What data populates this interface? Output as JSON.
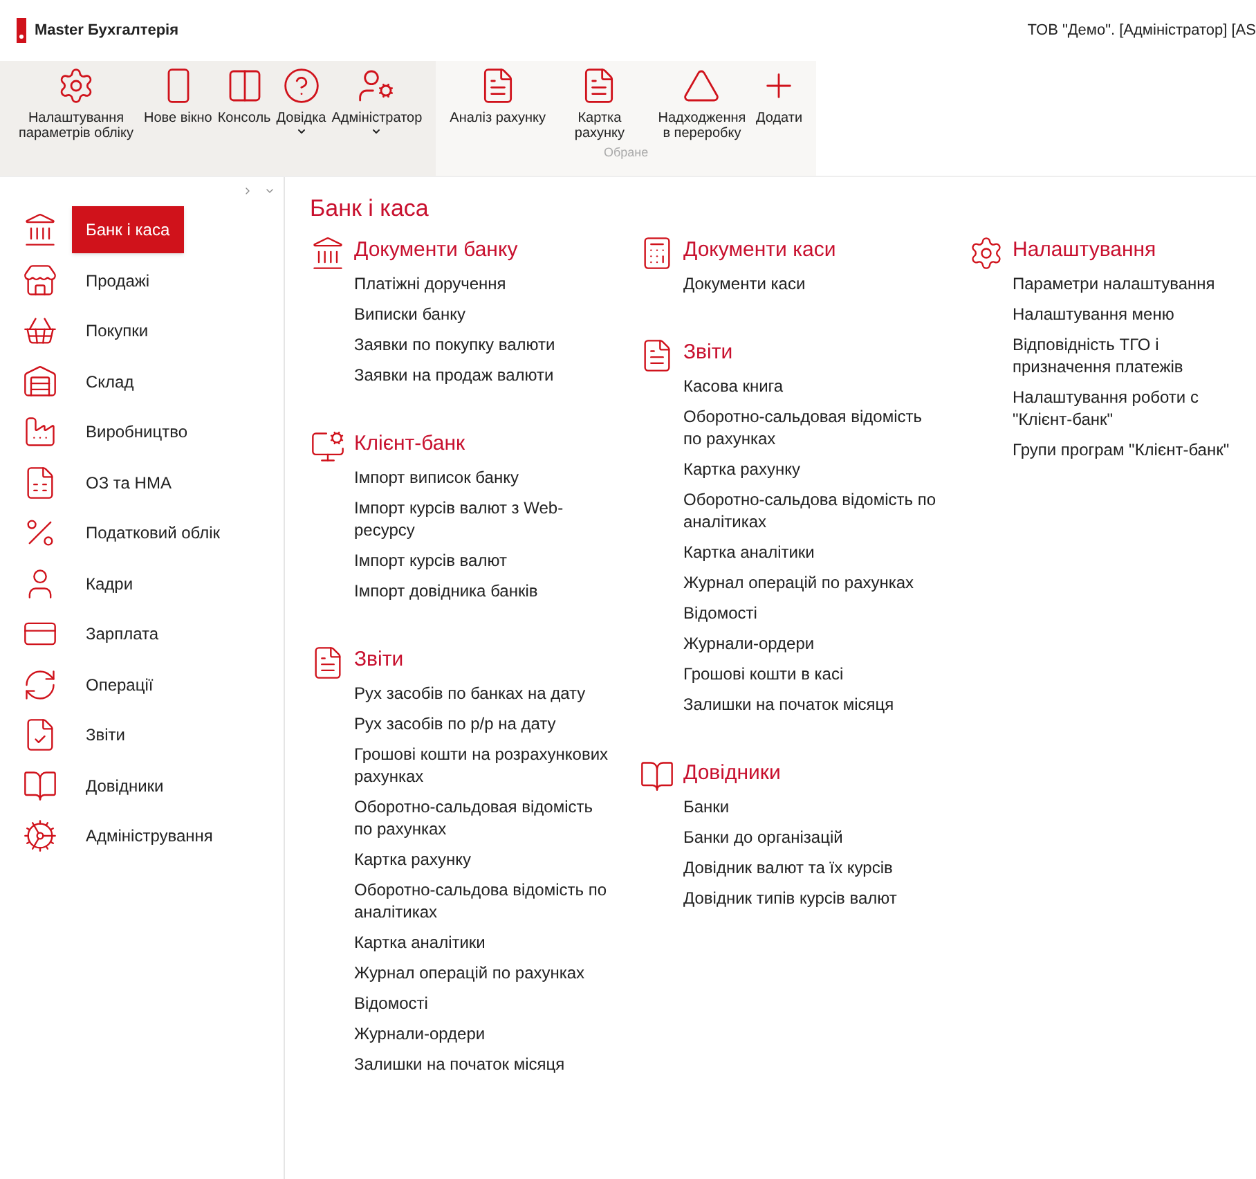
{
  "app": {
    "title": "Master Бухгалтерія",
    "context": "ТОВ \"Демо\". [Адміністратор] [AS"
  },
  "toolbar": {
    "groups": [
      {
        "items": [
          {
            "label": "Налаштування параметрів обліку",
            "dropdown": false
          },
          {
            "label": "Нове вікно",
            "dropdown": false
          },
          {
            "label": "Консоль",
            "dropdown": false
          },
          {
            "label": "Довідка",
            "dropdown": true
          },
          {
            "label": "Адміністратор",
            "dropdown": true
          }
        ]
      },
      {
        "caption": "Обране",
        "items": [
          {
            "label": "Аналіз рахунку",
            "dropdown": false
          },
          {
            "label": "Картка рахунку",
            "dropdown": false
          },
          {
            "label": "Надходження в переробку",
            "dropdown": false
          },
          {
            "label": "Додати",
            "dropdown": false
          }
        ]
      }
    ]
  },
  "sidebar": {
    "items": [
      {
        "label": "Банк і каса",
        "selected": true
      },
      {
        "label": "Продажі",
        "selected": false
      },
      {
        "label": "Покупки",
        "selected": false
      },
      {
        "label": "Склад",
        "selected": false
      },
      {
        "label": "Виробництво",
        "selected": false
      },
      {
        "label": "ОЗ та НМА",
        "selected": false
      },
      {
        "label": "Податковий облік",
        "selected": false
      },
      {
        "label": "Кадри",
        "selected": false
      },
      {
        "label": "Зарплата",
        "selected": false
      },
      {
        "label": "Операції",
        "selected": false
      },
      {
        "label": "Звіти",
        "selected": false
      },
      {
        "label": "Довідники",
        "selected": false
      },
      {
        "label": "Адміністрування",
        "selected": false
      }
    ]
  },
  "page": {
    "title": "Банк і каса",
    "columns": [
      {
        "sections": [
          {
            "title": "Документи банку",
            "links": [
              "Платіжні доручення",
              "Виписки банку",
              "Заявки по покупку валюти",
              "Заявки на продаж валюти"
            ]
          },
          {
            "title": "Клієнт-банк",
            "links": [
              "Імпорт виписок банку",
              "Імпорт курсів валют з Web-ресурсу",
              "Імпорт курсів валют",
              "Імпорт довідника банків"
            ]
          },
          {
            "title": "Звіти",
            "links": [
              "Рух засобів по банках на дату",
              "Рух засобів по р/р на дату",
              "Грошові кошти на розрахункових рахунках",
              "Оборотно-сальдовая відомість по рахунках",
              "Картка рахунку",
              "Оборотно-сальдова відомість по аналітиках",
              "Картка аналітики",
              "Журнал операцій по рахунках",
              "Відомості",
              "Журнали-ордери",
              "Залишки на початок місяця"
            ]
          }
        ]
      },
      {
        "sections": [
          {
            "title": "Документи каси",
            "links": [
              "Документи каси"
            ]
          },
          {
            "title": "Звіти",
            "links": [
              "Касова книга",
              "Оборотно-сальдовая відомість по рахунках",
              "Картка рахунку",
              "Оборотно-сальдова відомість по аналітиках",
              "Картка аналітики",
              "Журнал операцій по рахунках",
              "Відомості",
              "Журнали-ордери",
              "Грошові кошти в касі",
              "Залишки на початок місяця"
            ]
          },
          {
            "title": "Довідники",
            "links": [
              "Банки",
              "Банки до організацій",
              "Довідник валют та їх курсів",
              "Довідник типів курсів валют"
            ]
          }
        ]
      },
      {
        "sections": [
          {
            "title": "Налаштування",
            "links": [
              "Параметри налаштування",
              "Налаштування меню",
              "Відповідність ТГО і призначення платежів",
              "Налаштування роботи с \"Клієнт-банк\"",
              "Групи програм \"Клієнт-банк\""
            ]
          }
        ]
      }
    ]
  }
}
